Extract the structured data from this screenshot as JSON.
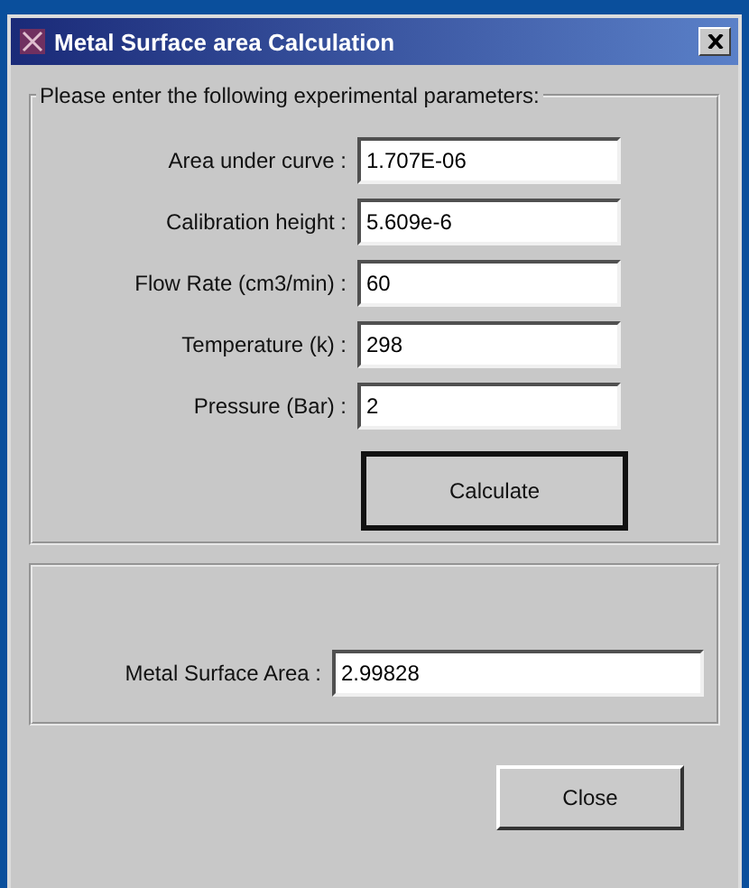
{
  "window": {
    "title": "Metal Surface area Calculation"
  },
  "parameters": {
    "legend": "Please enter the following experimental parameters:",
    "fields": [
      {
        "label": "Area under curve :",
        "value": "1.707E-06"
      },
      {
        "label": "Calibration height :",
        "value": "5.609e-6"
      },
      {
        "label": "Flow Rate (cm3/min) :",
        "value": "60"
      },
      {
        "label": "Temperature (k) :",
        "value": "298"
      },
      {
        "label": "Pressure (Bar) :",
        "value": "2"
      }
    ],
    "button": {
      "label": "Calculate",
      "default": true
    }
  },
  "result": {
    "label": "Metal Surface Area :",
    "value": "2.99828"
  },
  "buttons": [
    {
      "label": "Close",
      "default": false
    }
  ]
}
